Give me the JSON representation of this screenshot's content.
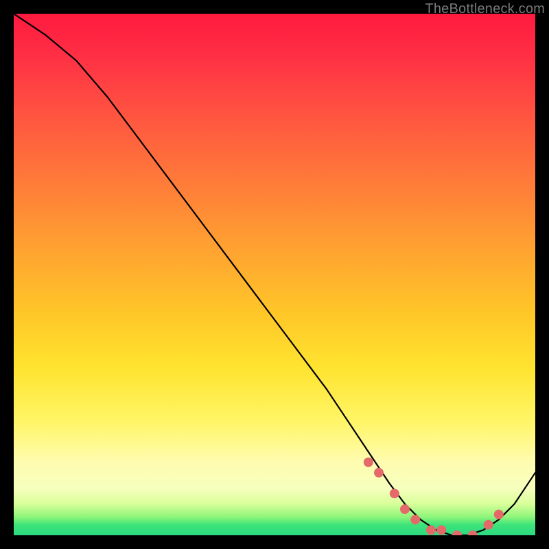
{
  "watermark": "TheBottleneck.com",
  "chart_data": {
    "type": "line",
    "title": "",
    "xlabel": "",
    "ylabel": "",
    "xlim": [
      0,
      100
    ],
    "ylim": [
      0,
      100
    ],
    "grid": false,
    "series": [
      {
        "name": "curve",
        "x": [
          0,
          6,
          12,
          18,
          24,
          30,
          36,
          42,
          48,
          54,
          60,
          64,
          68,
          72,
          75,
          78,
          81,
          84,
          87,
          90,
          93,
          96,
          100
        ],
        "y": [
          100,
          96,
          91,
          84,
          76,
          68,
          60,
          52,
          44,
          36,
          28,
          22,
          16,
          10,
          6,
          3,
          1,
          0,
          0,
          1,
          3,
          6,
          12
        ]
      }
    ],
    "markers": {
      "name": "highlight-points",
      "color": "#e46a6a",
      "x": [
        68,
        70,
        73,
        75,
        77,
        80,
        82,
        85,
        88,
        91,
        93
      ],
      "y": [
        14,
        12,
        8,
        5,
        3,
        1,
        1,
        0,
        0,
        2,
        4
      ]
    },
    "background_gradient": {
      "stops": [
        {
          "pos": 0.0,
          "color": "#ff1a3f"
        },
        {
          "pos": 0.46,
          "color": "#ffa530"
        },
        {
          "pos": 0.78,
          "color": "#fff566"
        },
        {
          "pos": 0.96,
          "color": "#8df57a"
        },
        {
          "pos": 1.0,
          "color": "#2cd980"
        }
      ]
    }
  }
}
